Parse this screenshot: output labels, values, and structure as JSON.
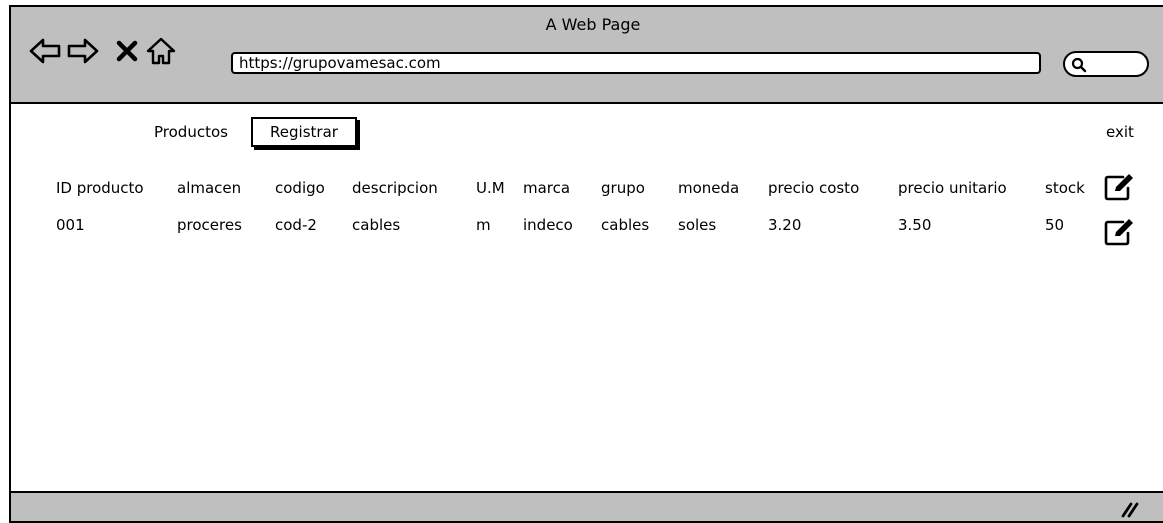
{
  "window": {
    "title": "A Web Page"
  },
  "browser": {
    "url": "https://grupovamesac.com",
    "icons": [
      "back-arrow-icon",
      "forward-arrow-icon",
      "stop-x-icon",
      "home-icon",
      "search-icon",
      "resize-grip-icon"
    ]
  },
  "topnav": {
    "productos_label": "Productos",
    "registrar_label": "Registrar",
    "exit_label": "exit"
  },
  "table": {
    "headers": [
      "ID producto",
      "almacen",
      "codigo",
      "descripcion",
      "U.M",
      "marca",
      "grupo",
      "moneda",
      "precio costo",
      "precio unitario",
      "stock"
    ],
    "rows": [
      [
        "001",
        "proceres",
        "cod-2",
        "cables",
        "m",
        "indeco",
        "cables",
        "soles",
        "3.20",
        "3.50",
        "50"
      ]
    ],
    "action_icon": "edit-icon"
  }
}
